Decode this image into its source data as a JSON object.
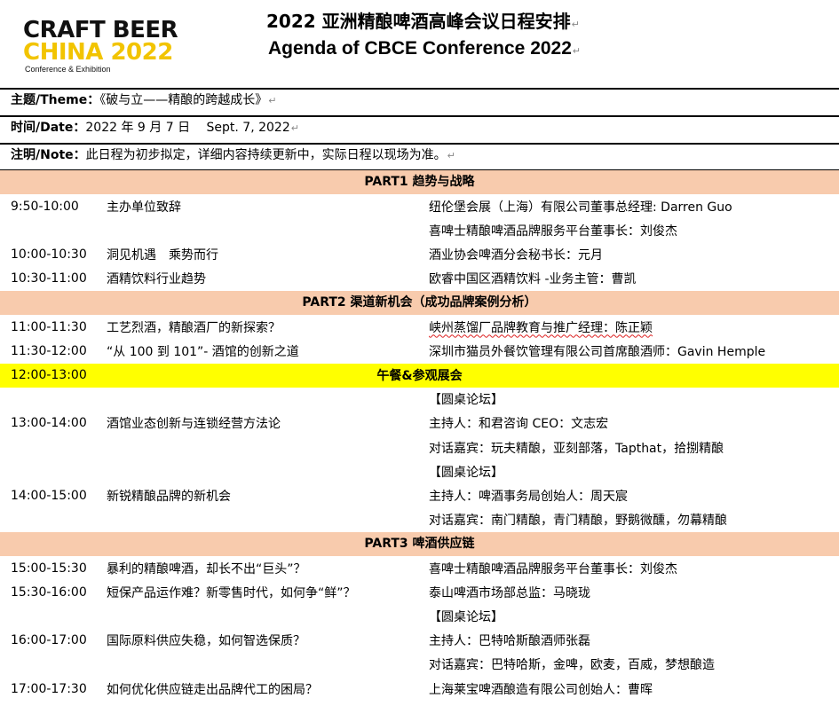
{
  "logo": {
    "line1": "CRAFT BEER",
    "line2": "CHINA 2022",
    "line3": "Conference & Exhibition"
  },
  "title_cn": "2022 亚洲精酿啤酒高峰会议日程安排",
  "title_en": "Agenda of CBCE Conference 2022",
  "para_mark": "↵",
  "theme": {
    "label": "主题/Theme：",
    "value": "《破与立——精酿的跨越成长》"
  },
  "date": {
    "label": "时间/Date：",
    "value": "2022 年 9 月 7 日　 Sept. 7, 2022"
  },
  "note": {
    "label": "注明/Note：",
    "value": "此日程为初步拟定，详细内容持续更新中，实际日程以现场为准。"
  },
  "colors": {
    "section_bg": "#f8cbad",
    "lunch_bg": "#ffff00"
  },
  "agenda": {
    "part1": "PART1 趋势与战略",
    "part2": "PART2 渠道新机会（成功品牌案例分析）",
    "part3": "PART3 啤酒供应链",
    "r1": {
      "time": "9:50-10:00",
      "topic": "主办单位致辞",
      "speaker1": "纽伦堡会展（上海）有限公司董事总经理: Darren Guo",
      "speaker2": "喜啤士精酿啤酒品牌服务平台董事长：刘俊杰"
    },
    "r2": {
      "time": "10:00-10:30",
      "topic": "洞见机遇　乘势而行",
      "speaker": "酒业协会啤酒分会秘书长：元月"
    },
    "r3": {
      "time": "10:30-11:00",
      "topic": "酒精饮料行业趋势",
      "speaker": "欧睿中国区酒精饮料 -业务主管：曹凯"
    },
    "r4": {
      "time": "11:00-11:30",
      "topic": "工艺烈酒，精酿酒厂的新探索？",
      "speaker": "峡州蒸馏厂品牌教育与推广经理：陈正颖"
    },
    "r5": {
      "time": "11:30-12:00",
      "topic": "“从 100 到 101”- 酒馆的创新之道",
      "speaker": "深圳市猫员外餐饮管理有限公司首席酿酒师：Gavin Hemple"
    },
    "lunch": {
      "time": "12:00-13:00",
      "label": "午餐&参观展会"
    },
    "r6": {
      "time": "13:00-14:00",
      "topic": "酒馆业态创新与连锁经营方法论",
      "forum": "【圆桌论坛】",
      "host": "主持人：和君咨询 CEO：文志宏",
      "guests": "对话嘉宾：玩夫精酿，亚刻部落，Tapthat，拾捌精酿"
    },
    "r7": {
      "time": "14:00-15:00",
      "topic": "新锐精酿品牌的新机会",
      "forum": "【圆桌论坛】",
      "host": "主持人：啤酒事务局创始人：周天宸",
      "guests": "对话嘉宾：南门精酿，青门精酿，野鹅微醺，勿幕精酿"
    },
    "r8": {
      "time": "15:00-15:30",
      "topic": "暴利的精酿啤酒，却长不出“巨头”？",
      "speaker": "喜啤士精酿啤酒品牌服务平台董事长：刘俊杰"
    },
    "r9": {
      "time": "15:30-16:00",
      "topic": "短保产品运作难？新零售时代，如何争“鲜”？",
      "speaker": "泰山啤酒市场部总监：马晓珑"
    },
    "r10": {
      "time": "16:00-17:00",
      "topic": "国际原料供应失稳，如何智选保质？",
      "forum": "【圆桌论坛】",
      "host": "主持人：巴特哈斯酿酒师张磊",
      "guests": "对话嘉宾：巴特哈斯，金啤，欧麦，百威，梦想酿造"
    },
    "r11": {
      "time": "17:00-17:30",
      "topic": "如何优化供应链走出品牌代工的困局？",
      "speaker": "上海莱宝啤酒酿造有限公司创始人：曹晖"
    }
  }
}
